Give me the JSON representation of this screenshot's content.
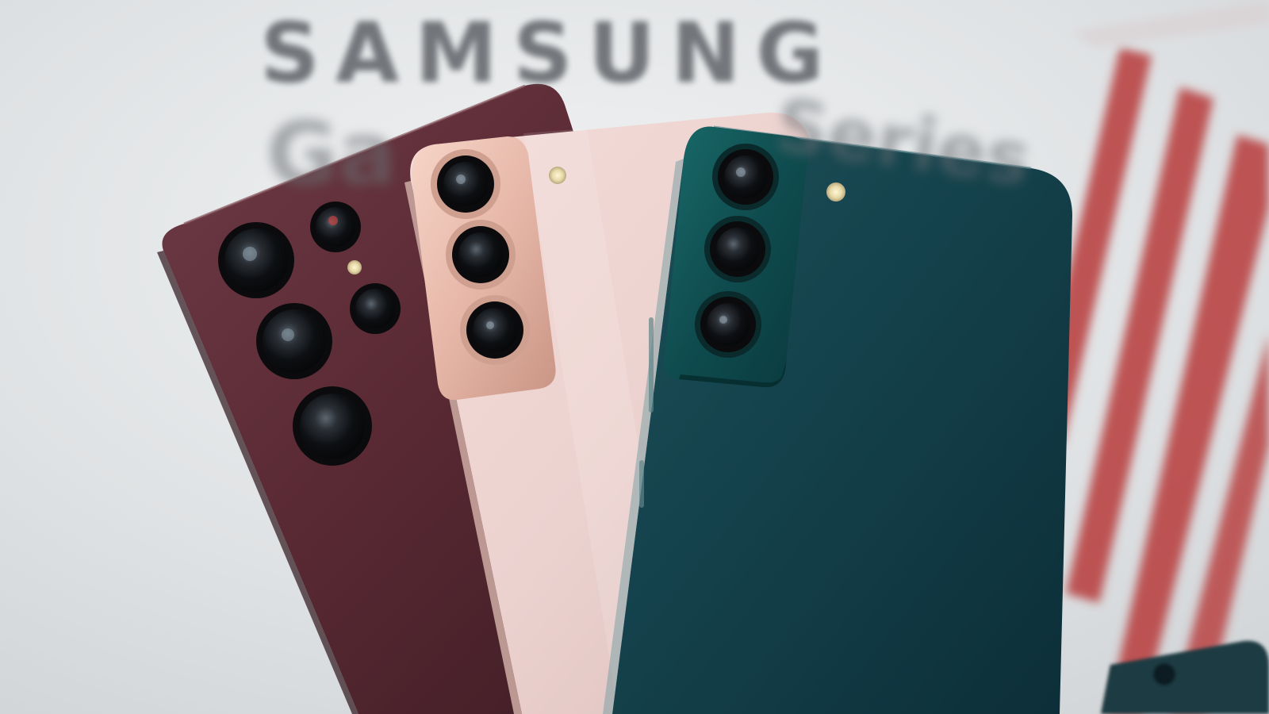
{
  "background": {
    "brand_text": "SAMSUNG",
    "series_text_left": "Ga",
    "series_text_right": "Series"
  },
  "colors": {
    "backdrop": "#dfe2e4",
    "stripe_red": "#b94242",
    "burgundy_phone": "#5a2a34",
    "pink_phone": "#ecd2cf",
    "rose_gold_frame": "#e6b7a8",
    "green_phone": "#133e48",
    "green_camera_bump": "#0f4c4f"
  },
  "phones": [
    {
      "finish": "burgundy",
      "cameras": 5
    },
    {
      "finish": "pink",
      "cameras": 3
    },
    {
      "finish": "green",
      "cameras": 3
    }
  ]
}
